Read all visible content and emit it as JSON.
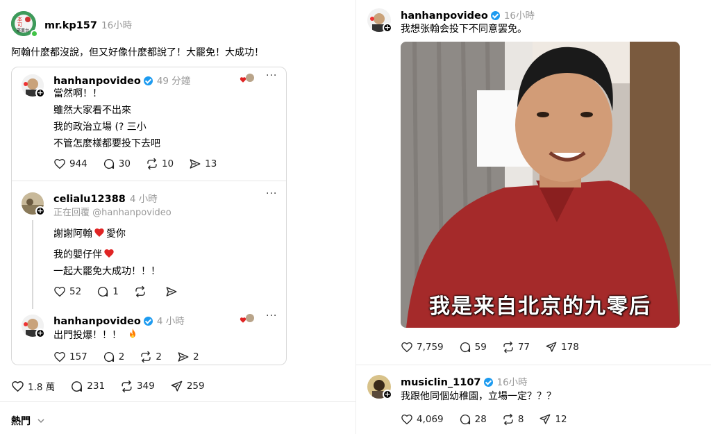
{
  "left": {
    "post": {
      "username": "mr.kp157",
      "time": "16小時",
      "text": "阿翰什麼都沒說，但又好像什麼都說了！大罷免！大成功！",
      "avatar_text_1": "本",
      "avatar_text_2": "可",
      "avatar_text_3": "罷業台",
      "likes": "1.8 萬",
      "comments": "231",
      "reposts": "349",
      "shares": "259"
    },
    "quote1": {
      "username": "hanhanpovideo",
      "time": "49 分鐘",
      "lines": [
        "當然啊！！",
        "雖然大家看不出來",
        "我的政治立場 (? 三小",
        "不管怎麼樣都要投下去吧"
      ],
      "likes": "944",
      "comments": "30",
      "reposts": "10",
      "shares": "13"
    },
    "quote2": {
      "username": "celialu12388",
      "time": "4 小時",
      "replying": "正在回覆 @hanhanpovideo",
      "line1": "謝謝阿翰",
      "line1b": "愛你",
      "line2": "我的嬰仔伴",
      "line3": "一起大罷免大成功！！！",
      "likes": "52",
      "comments": "1"
    },
    "quote3": {
      "username": "hanhanpovideo",
      "time": "4 小時",
      "text": "出門投爆！！！",
      "likes": "157",
      "comments": "2",
      "reposts": "2",
      "shares": "2"
    },
    "sort_label": "熱門"
  },
  "right": {
    "post1": {
      "username": "hanhanpovideo",
      "time": "16小時",
      "text": "我想张翰会投下不同意罢免。",
      "video_subtitle": "我是来自北京的九零后",
      "likes": "7,759",
      "comments": "59",
      "reposts": "77",
      "shares": "178"
    },
    "post2": {
      "username": "musiclin_1107",
      "time": "16小時",
      "text": "我跟他同個幼稚園，立場一定？？？",
      "likes": "4,069",
      "comments": "28",
      "reposts": "8",
      "shares": "12"
    }
  },
  "icons": {
    "like": "heart-icon",
    "comment": "comment-bubble-icon",
    "repost": "repost-arrows-icon",
    "share": "send-paper-plane-icon",
    "more": "more-dots-icon"
  },
  "colors": {
    "verified": "#1d9bf0",
    "heart": "#e02424",
    "fire": "#ff7a00"
  }
}
